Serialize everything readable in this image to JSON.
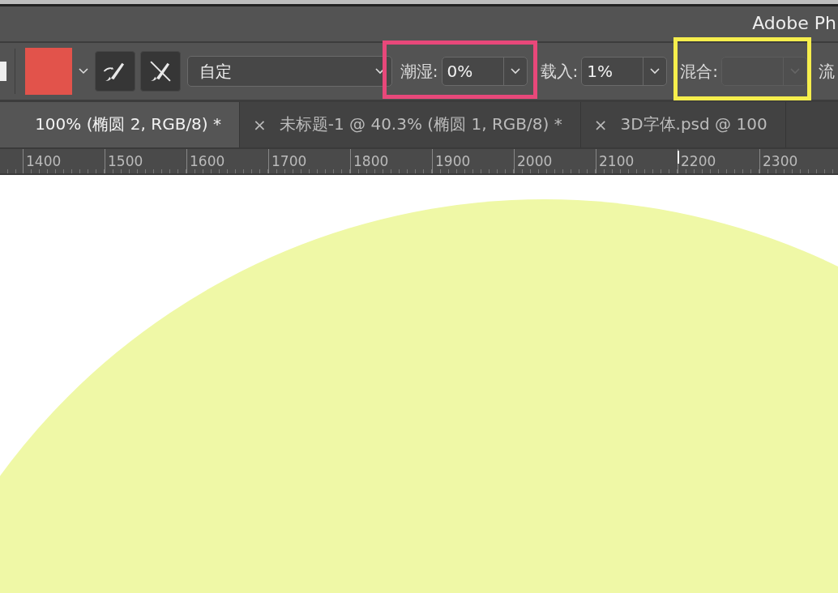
{
  "title_bar": {
    "title": "Adobe Ph"
  },
  "options_bar": {
    "preset": {
      "value": "自定"
    },
    "fields": [
      {
        "label": "潮湿:",
        "value": "0%",
        "disabled": false,
        "color": "#e8487a"
      },
      {
        "label": "载入:",
        "value": "1%",
        "disabled": false
      },
      {
        "label": "混合:",
        "disabled": true,
        "color": "#f6ee4c"
      }
    ],
    "trailing_label": "流"
  },
  "tabs": [
    {
      "label": "100% (椭圆 2, RGB/8) *",
      "selected": true
    },
    {
      "close": "×",
      "label": "未标题-1 @ 40.3% (椭圆 1, RGB/8) *",
      "selected": false
    },
    {
      "close": "×",
      "label": "3D字体.psd @ 100",
      "selected": false
    }
  ],
  "ruler": {
    "labels": [
      "1400",
      "1500",
      "1600",
      "1700",
      "1800",
      "1900",
      "2000",
      "2100",
      "2200",
      "2300"
    ]
  }
}
